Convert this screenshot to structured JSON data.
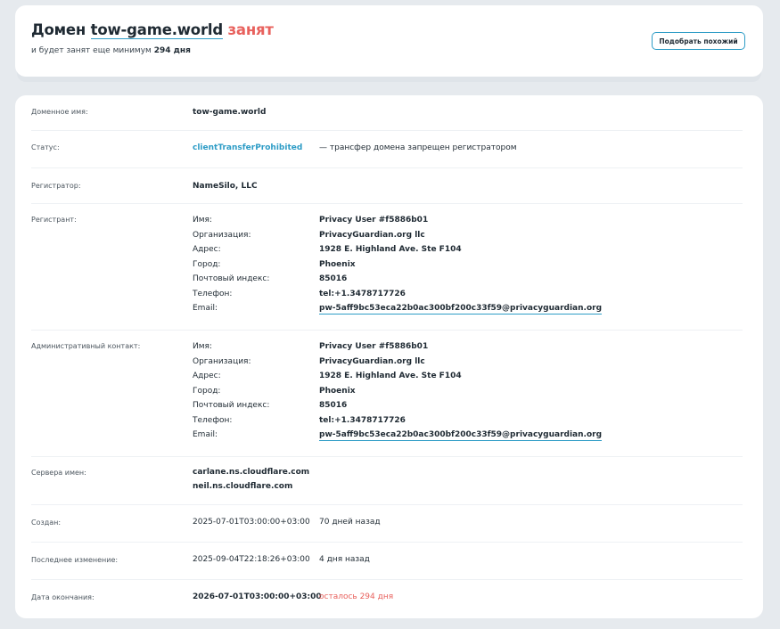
{
  "header": {
    "prefix": "Домен",
    "domain": "tow-game.world",
    "status": "занят",
    "sub_text": "и будет занят еще минимум",
    "sub_days": "294 дня",
    "similar_button": "Подобрать похожий"
  },
  "info": {
    "domain_name": {
      "label": "Доменное имя:",
      "value": "tow-game.world"
    },
    "status": {
      "label": "Статус:",
      "value": "clientTransferProhibited",
      "description": "— трансфер домена запрещен регистратором"
    },
    "registrar": {
      "label": "Регистратор:",
      "value": "NameSilo, LLC"
    },
    "registrant": {
      "label": "Регистрант:",
      "fields": [
        {
          "key": "Имя:",
          "value": "Privacy User #f5886b01"
        },
        {
          "key": "Организация:",
          "value": "PrivacyGuardian.org llc"
        },
        {
          "key": "Адрес:",
          "value": "1928 E. Highland Ave. Ste F104"
        },
        {
          "key": "Город:",
          "value": "Phoenix"
        },
        {
          "key": "Почтовый индекс:",
          "value": "85016"
        },
        {
          "key": "Телефон:",
          "value": "tel:+1.3478717726"
        },
        {
          "key": "Email:",
          "value": "pw-5aff9bc53eca22b0ac300bf200c33f59@privacyguardian.org"
        }
      ]
    },
    "admin_contact": {
      "label": "Административный контакт:",
      "fields": [
        {
          "key": "Имя:",
          "value": "Privacy User #f5886b01"
        },
        {
          "key": "Организация:",
          "value": "PrivacyGuardian.org llc"
        },
        {
          "key": "Адрес:",
          "value": "1928 E. Highland Ave. Ste F104"
        },
        {
          "key": "Город:",
          "value": "Phoenix"
        },
        {
          "key": "Почтовый индекс:",
          "value": "85016"
        },
        {
          "key": "Телефон:",
          "value": "tel:+1.3478717726"
        },
        {
          "key": "Email:",
          "value": "pw-5aff9bc53eca22b0ac300bf200c33f59@privacyguardian.org"
        }
      ]
    },
    "name_servers": {
      "label": "Сервера имен:",
      "values": [
        "carlane.ns.cloudflare.com",
        "neil.ns.cloudflare.com"
      ]
    },
    "created": {
      "label": "Создан:",
      "value": "2025-07-01T03:00:00+03:00",
      "relative": "70 дней назад"
    },
    "updated": {
      "label": "Последнее изменение:",
      "value": "2025-09-04T22:18:26+03:00",
      "relative": "4 дня назад"
    },
    "expires": {
      "label": "Дата окончания:",
      "value": "2026-07-01T03:00:00+03:00",
      "relative": "осталось 294 дня"
    }
  },
  "colors": {
    "accent": "#2d9cc6",
    "danger": "#e8615d",
    "background": "#e6eaee"
  }
}
